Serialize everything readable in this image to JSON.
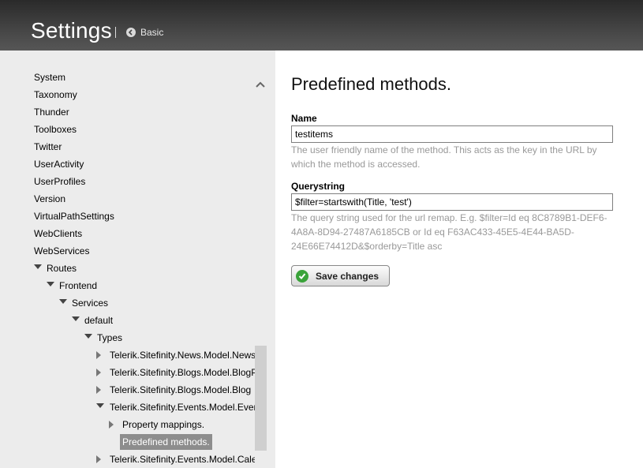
{
  "header": {
    "title": "Settings",
    "back_link": "Basic"
  },
  "sidebar": {
    "items": [
      {
        "label": "System"
      },
      {
        "label": "Taxonomy"
      },
      {
        "label": "Thunder"
      },
      {
        "label": "Toolboxes"
      },
      {
        "label": "Twitter"
      },
      {
        "label": "UserActivity"
      },
      {
        "label": "UserProfiles"
      },
      {
        "label": "Version"
      },
      {
        "label": "VirtualPathSettings"
      },
      {
        "label": "WebClients"
      },
      {
        "label": "WebServices"
      },
      {
        "label": "Routes",
        "toggle": "expanded"
      },
      {
        "label": "Frontend",
        "toggle": "expanded"
      },
      {
        "label": "Services",
        "toggle": "expanded"
      },
      {
        "label": "default",
        "toggle": "expanded"
      },
      {
        "label": "Types",
        "toggle": "expanded"
      },
      {
        "label": "Telerik.Sitefinity.News.Model.News",
        "toggle": "collapsed"
      },
      {
        "label": "Telerik.Sitefinity.Blogs.Model.BlogPost",
        "toggle": "collapsed"
      },
      {
        "label": "Telerik.Sitefinity.Blogs.Model.Blog",
        "toggle": "collapsed"
      },
      {
        "label": "Telerik.Sitefinity.Events.Model.Event",
        "toggle": "expanded"
      },
      {
        "label": "Property mappings.",
        "toggle": "collapsed"
      },
      {
        "label": "Predefined methods.",
        "selected": true
      },
      {
        "label": "Telerik.Sitefinity.Events.Model.Calendar",
        "toggle": "collapsed"
      }
    ]
  },
  "main": {
    "title": "Predefined methods.",
    "name_label": "Name",
    "name_value": "testitems",
    "name_help": "The user friendly name of the method. This acts as the key in the URL by which the method is accessed.",
    "querystring_label": "Querystring",
    "querystring_value": "$filter=startswith(Title, 'test')",
    "querystring_help": "The query string used for the url remap. E.g. $filter=Id eq 8C8789B1-DEF6-4A8A-8D94-27487A6185CB or Id eq F63AC433-45E5-4E44-BA5D-24E66E74412D&$orderby=Title asc",
    "save_label": "Save changes"
  }
}
